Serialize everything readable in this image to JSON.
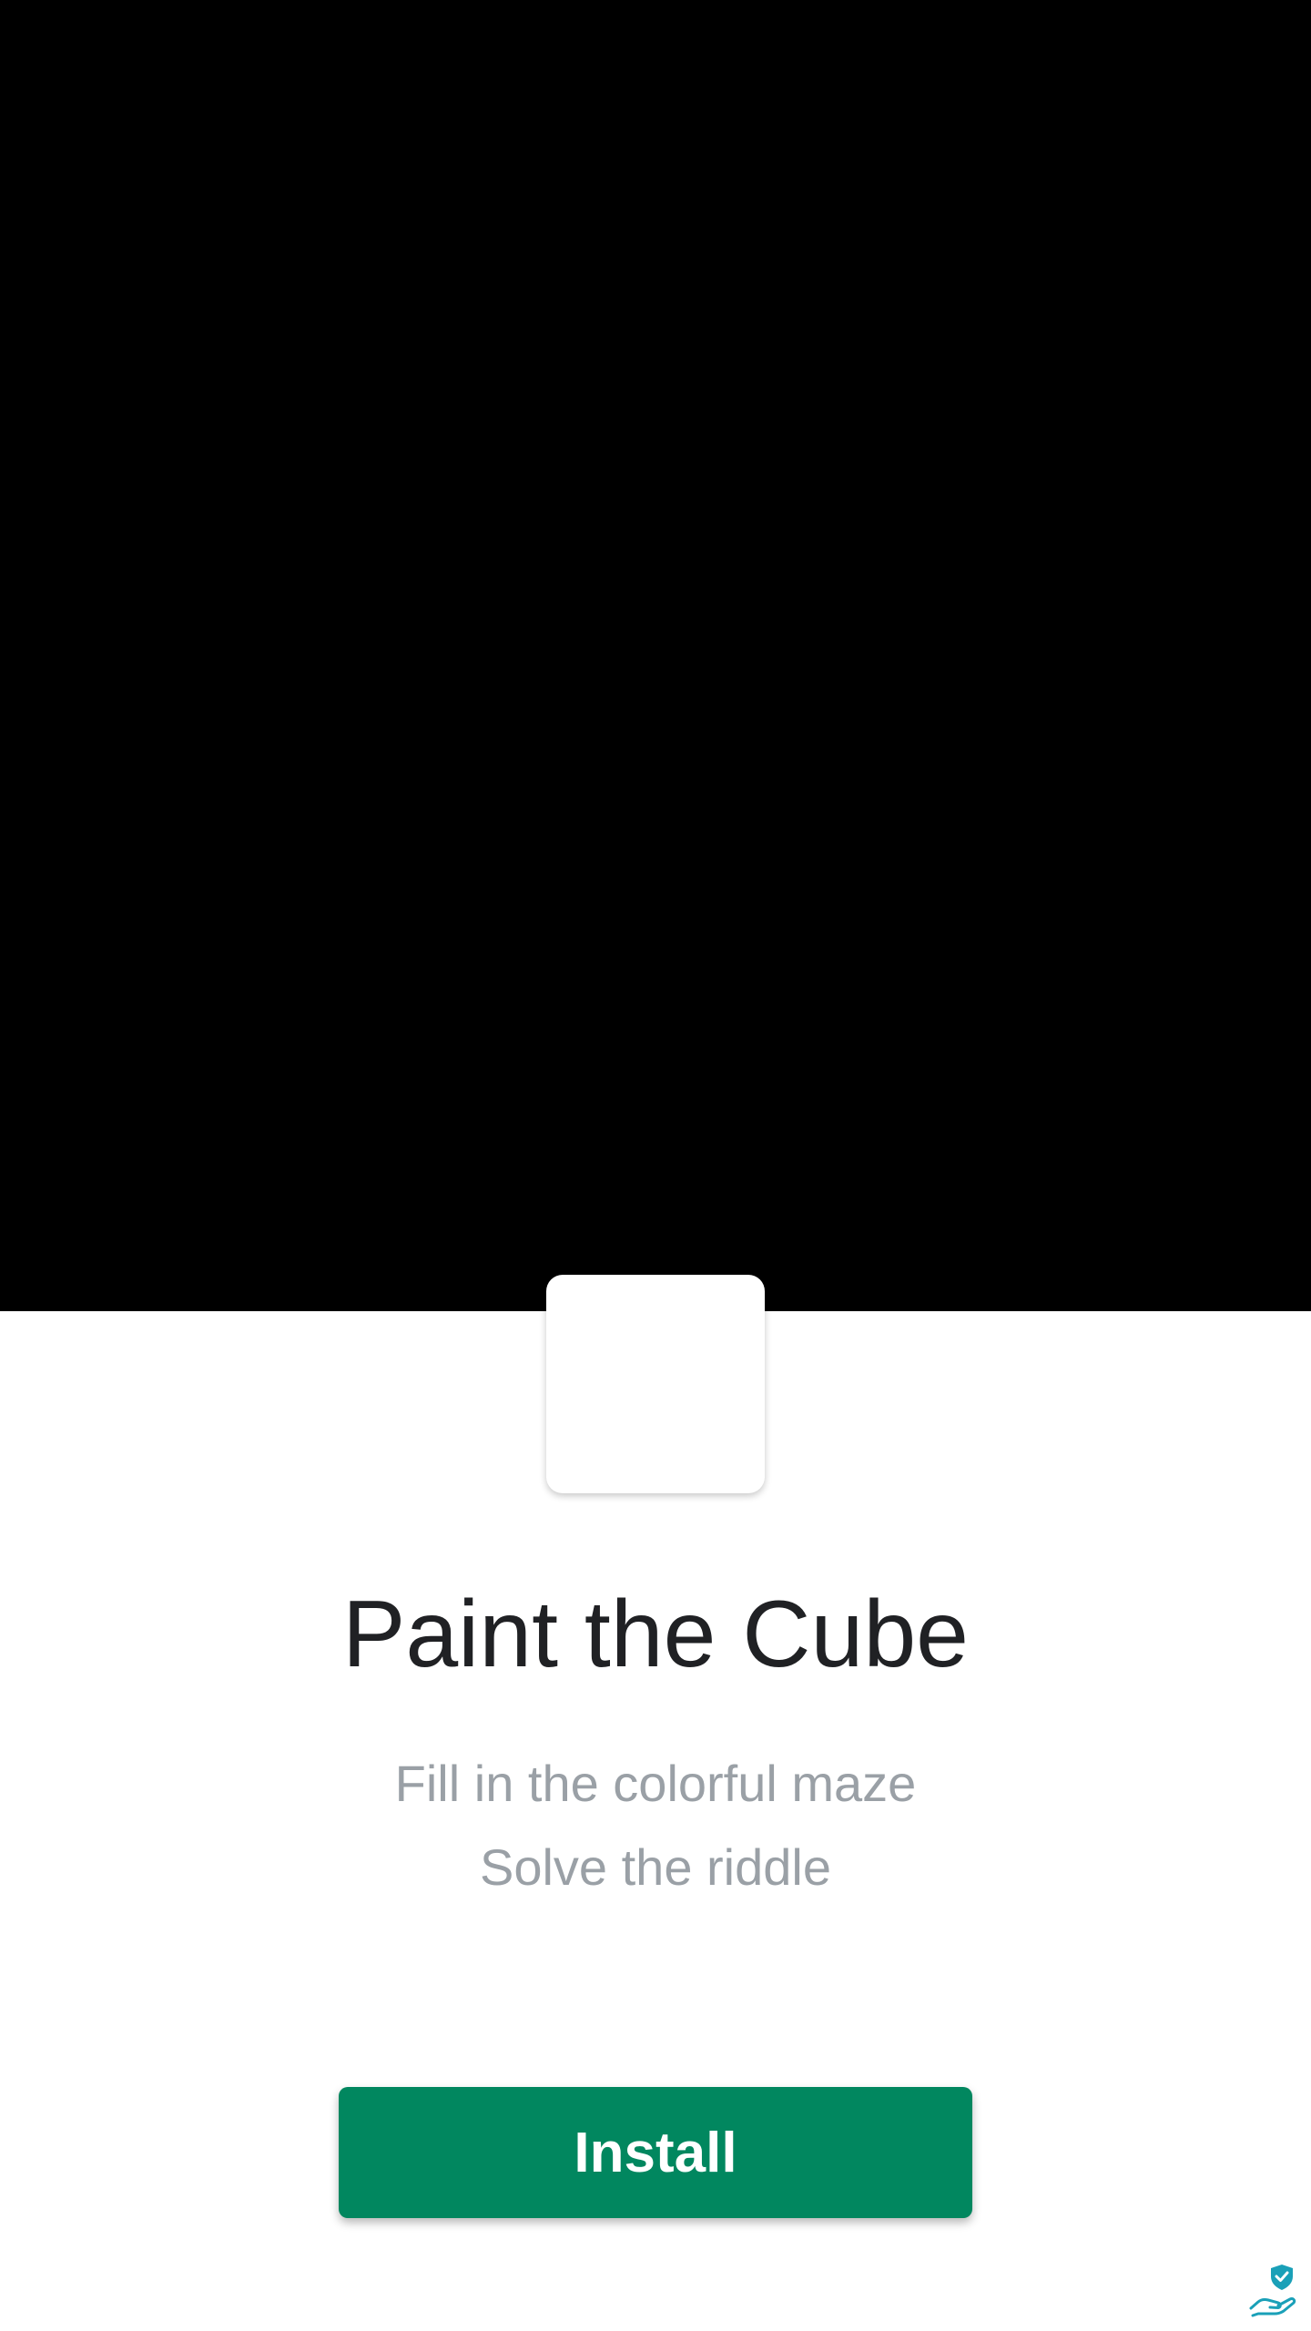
{
  "app": {
    "title": "Paint the Cube",
    "tagline_1": "Fill in the colorful maze",
    "tagline_2": "Solve the riddle"
  },
  "actions": {
    "install_label": "Install"
  },
  "icons": {
    "ad_badge": "shield-hand-icon"
  },
  "colors": {
    "install_button": "#01875f",
    "title_text": "#202124",
    "tagline_text": "#9aa0a6",
    "badge": "#1aa0b8"
  }
}
